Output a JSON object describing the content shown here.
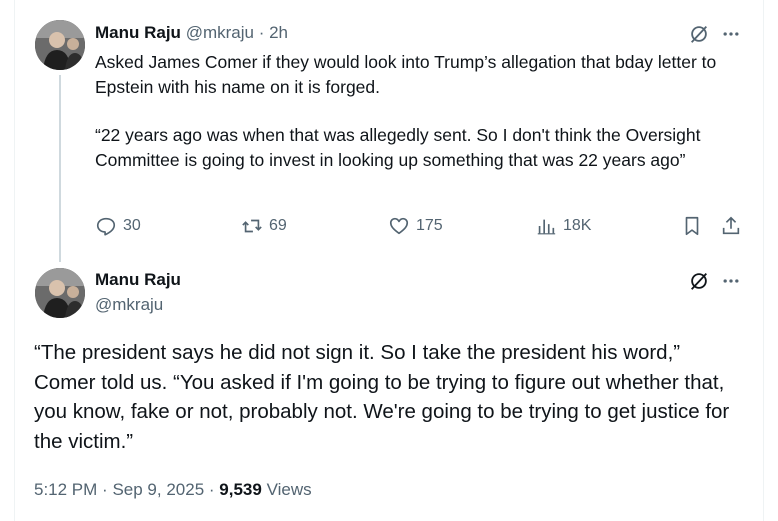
{
  "tweet1": {
    "name": "Manu Raju",
    "handle": "@mkraju",
    "separator": "·",
    "time": "2h",
    "paragraph1": "Asked James Comer if they would look into Trump’s allegation that bday letter to Epstein with his name on it is forged.",
    "paragraph2": "“22 years ago was when that was allegedly sent. So I don't think the Oversight Committee is going to invest in looking up something that was 22 years ago”",
    "actions": {
      "replies": "30",
      "reposts": "69",
      "likes": "175",
      "views": "18K"
    }
  },
  "tweet2": {
    "name": "Manu Raju",
    "handle": "@mkraju",
    "body": "“The president says he did not sign it. So I take the president his word,” Comer told us. “You asked if I'm going to be trying to figure out whether that, you know, fake or not, probably not. We're going to be trying to get justice for the victim.”",
    "time": "5:12 PM",
    "separator": "·",
    "date": "Sep 9, 2025",
    "separator2": "·",
    "views_count": "9,539",
    "views_label": "Views"
  },
  "icons": {
    "grok": "grok-icon",
    "more": "more-icon",
    "reply": "reply-icon",
    "repost": "repost-icon",
    "like": "like-icon",
    "views": "views-icon",
    "bookmark": "bookmark-icon",
    "share": "share-icon"
  },
  "colors": {
    "text_primary": "#0f1419",
    "text_secondary": "#536471",
    "thread_line": "#cfd9de"
  }
}
